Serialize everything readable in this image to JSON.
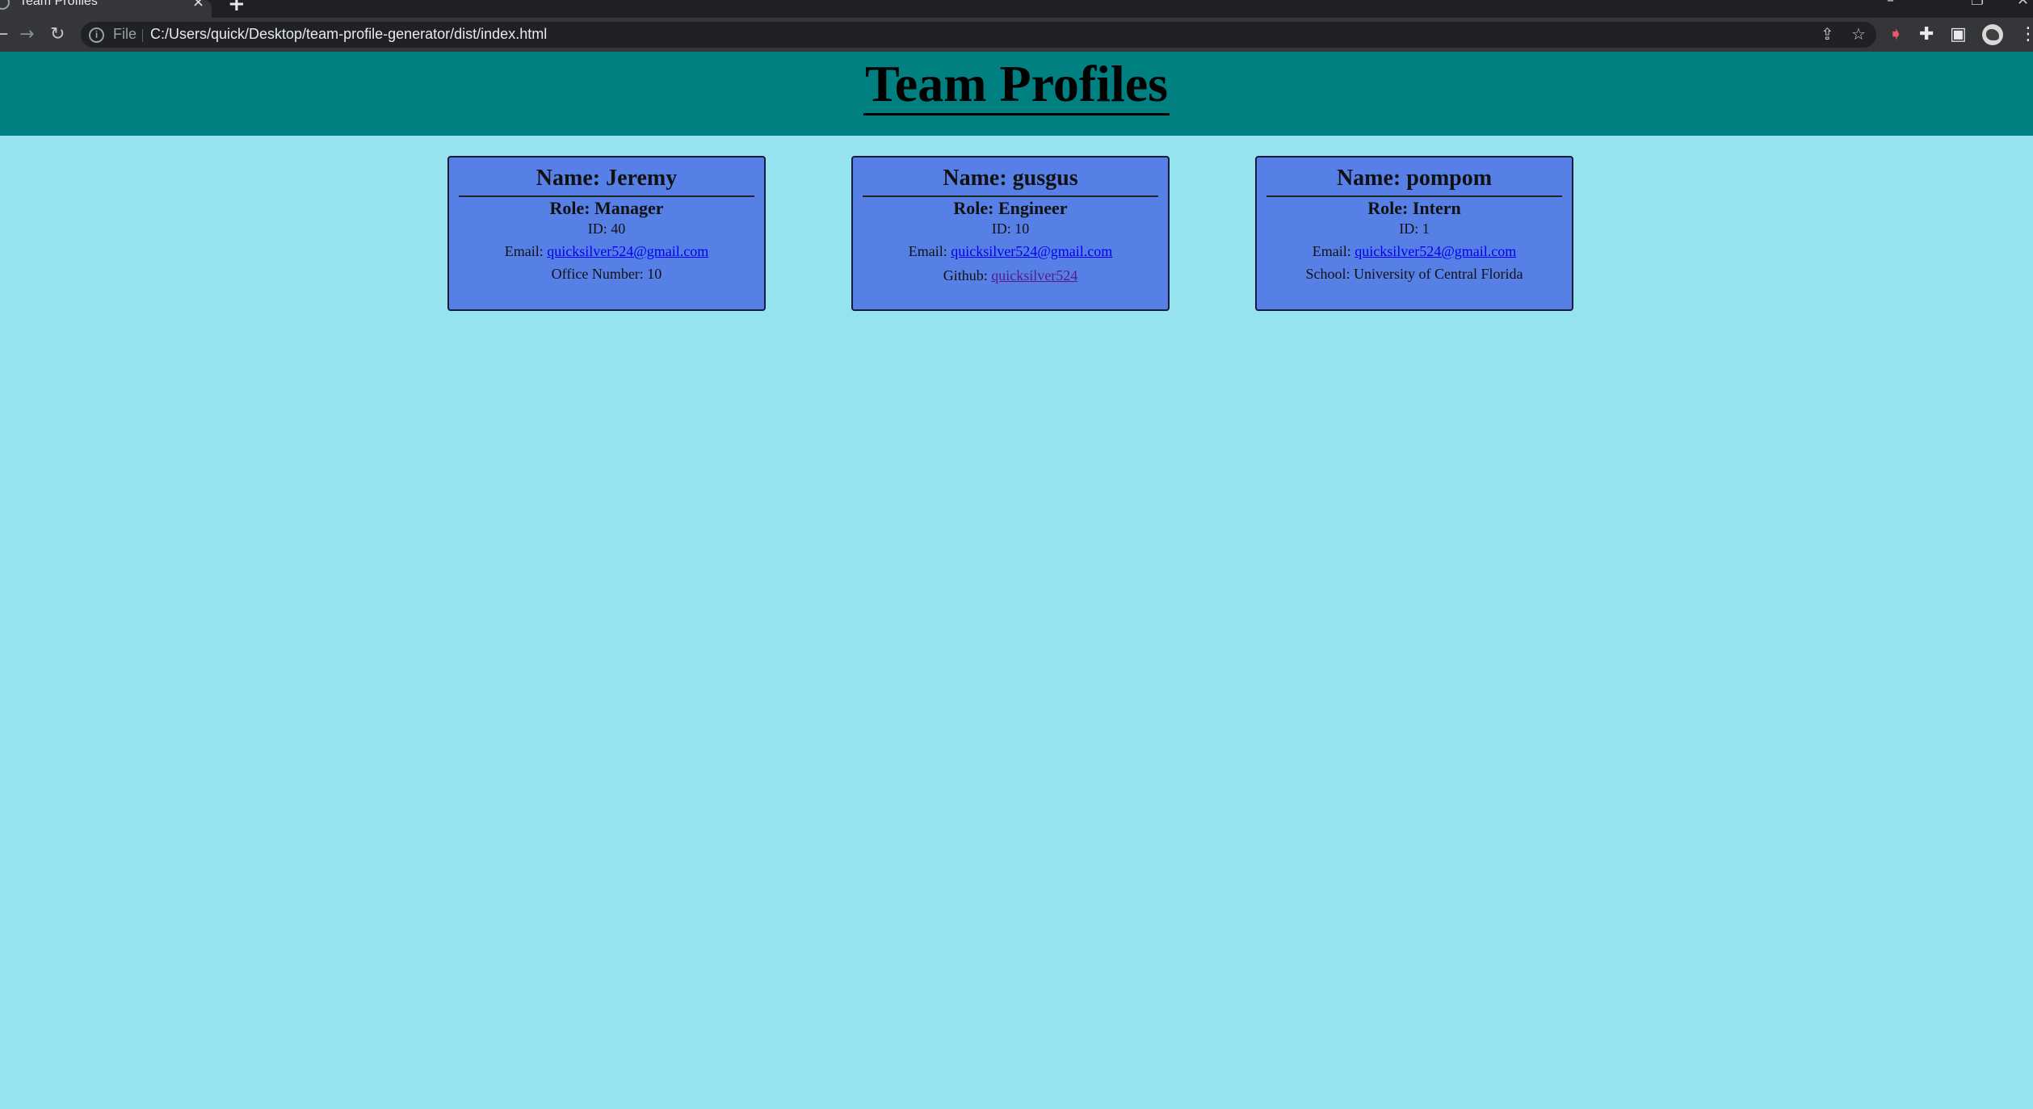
{
  "browser": {
    "tab_title": "Team Profiles",
    "file_label": "File",
    "url": "C:/Users/quick/Desktop/team-profile-generator/dist/index.html",
    "icons": [
      "back-icon",
      "forward-icon",
      "reload-icon",
      "info-icon",
      "share-icon",
      "star-icon",
      "extension-icon",
      "puzzle-icon",
      "sidepanel-icon",
      "avatar",
      "menu-icon"
    ]
  },
  "header": {
    "title": "Team Profiles",
    "background": "#008080"
  },
  "page_background": "#94e3ef",
  "card_background": "#5780e6",
  "team": [
    {
      "name": "Name: Jeremy",
      "role": "Role: Manager",
      "id": "ID: 40",
      "email_label": "Email: ",
      "email": "quicksilver524@gmail.com",
      "extra_label": "Office Number: 10",
      "extra_link": ""
    },
    {
      "name": "Name: gusgus",
      "role": "Role: Engineer",
      "id": "ID: 10",
      "email_label": "Email: ",
      "email": "quicksilver524@gmail.com",
      "extra_label": "Github: ",
      "extra_link": "quicksilver524"
    },
    {
      "name": "Name: pompom",
      "role": "Role: Intern",
      "id": "ID: 1",
      "email_label": "Email: ",
      "email": "quicksilver524@gmail.com",
      "extra_label": "School: University of Central Florida",
      "extra_link": ""
    }
  ]
}
